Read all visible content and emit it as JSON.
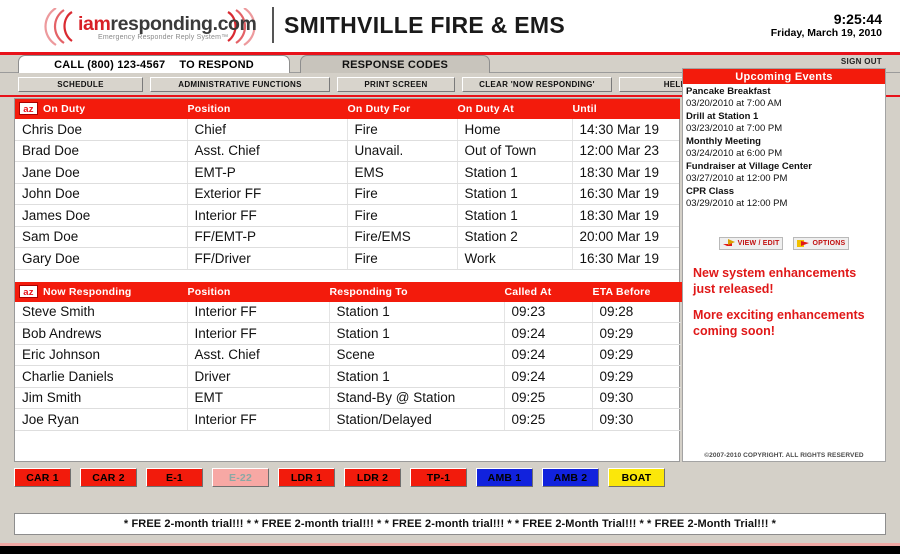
{
  "header": {
    "logo": {
      "brand_part1": "iam",
      "brand_part2": "responding.com",
      "tagline": "Emergency Responder Reply System™",
      "icon_left": "sound-wave-left-icon",
      "icon_right": "sound-wave-right-icon"
    },
    "department_title": "SMITHVILLE FIRE & EMS",
    "clock_time": "9:25:44",
    "clock_date": "Friday, March 19, 2010"
  },
  "tabs": [
    {
      "id": "tab-respond",
      "label_bold": "CALL (800) 123-4567",
      "label_strong": "TO RESPOND",
      "active": true
    },
    {
      "id": "tab-codes",
      "label_bold": "RESPONSE CODES",
      "active": false
    }
  ],
  "toolbar": {
    "schedule_label": "SCHEDULE",
    "admin_label": "ADMINISTRATIVE FUNCTIONS",
    "print_label": "PRINT SCREEN",
    "clear_label": "CLEAR 'NOW RESPONDING'",
    "help_label": "HELP",
    "sign_out_label": "SIGN OUT"
  },
  "on_duty": {
    "sort_badge": "az",
    "columns": [
      "On Duty",
      "Position",
      "On Duty For",
      "On Duty At",
      "Until"
    ],
    "rows": [
      {
        "name": "Chris Doe",
        "position": "Chief",
        "duty_for": "Fire",
        "duty_at": "Home",
        "until": "14:30 Mar 19"
      },
      {
        "name": "Brad Doe",
        "position": "Asst. Chief",
        "duty_for": "Unavail.",
        "duty_at": "Out of Town",
        "until": "12:00 Mar 23"
      },
      {
        "name": "Jane Doe",
        "position": "EMT-P",
        "duty_for": "EMS",
        "duty_at": "Station 1",
        "until": "18:30 Mar 19"
      },
      {
        "name": "John Doe",
        "position": "Exterior FF",
        "duty_for": "Fire",
        "duty_at": "Station 1",
        "until": "16:30 Mar 19"
      },
      {
        "name": "James Doe",
        "position": "Interior FF",
        "duty_for": "Fire",
        "duty_at": "Station 1",
        "until": "18:30 Mar 19"
      },
      {
        "name": "Sam Doe",
        "position": "FF/EMT-P",
        "duty_for": "Fire/EMS",
        "duty_at": "Station 2",
        "until": "20:00 Mar 19"
      },
      {
        "name": "Gary Doe",
        "position": "FF/Driver",
        "duty_for": "Fire",
        "duty_at": "Work",
        "until": "16:30 Mar 19"
      }
    ]
  },
  "now_responding": {
    "sort_badge": "az",
    "columns": [
      "Now Responding",
      "Position",
      "Responding To",
      "Called At",
      "ETA Before"
    ],
    "rows": [
      {
        "name": "Steve Smith",
        "position": "Interior FF",
        "responding_to": "Station 1",
        "called_at": "09:23",
        "eta_before": "09:28"
      },
      {
        "name": "Bob Andrews",
        "position": "Interior FF",
        "responding_to": "Station 1",
        "called_at": "09:24",
        "eta_before": "09:29"
      },
      {
        "name": "Eric Johnson",
        "position": "Asst. Chief",
        "responding_to": "Scene",
        "called_at": "09:24",
        "eta_before": "09:29"
      },
      {
        "name": "Charlie Daniels",
        "position": "Driver",
        "responding_to": "Station 1",
        "called_at": "09:24",
        "eta_before": "09:29"
      },
      {
        "name": "Jim Smith",
        "position": "EMT",
        "responding_to": "Stand-By @ Station",
        "called_at": "09:25",
        "eta_before": "09:30"
      },
      {
        "name": "Joe Ryan",
        "position": "Interior FF",
        "responding_to": "Station/Delayed",
        "called_at": "09:25",
        "eta_before": "09:30"
      }
    ]
  },
  "sidebar": {
    "title": "Upcoming Events",
    "events": [
      {
        "name": "Pancake Breakfast",
        "when": "03/20/2010 at 7:00 AM"
      },
      {
        "name": "Drill at Station 1",
        "when": "03/23/2010 at 7:00 PM"
      },
      {
        "name": "Monthly Meeting",
        "when": "03/24/2010 at 6:00 PM"
      },
      {
        "name": "Fundraiser at Village Center",
        "when": "03/27/2010 at 12:00 PM"
      },
      {
        "name": "CPR Class",
        "when": "03/29/2010 at 12:00 PM"
      }
    ],
    "view_edit_label": "VIEW / EDIT",
    "options_label": "OPTIONS",
    "view_edit_icon": "pencil-flag-icon",
    "options_icon": "wrench-flag-icon",
    "promo_lines": [
      "New system enhancements just released!",
      "More exciting enhancements coming soon!"
    ],
    "copyright": "©2007-2010 COPYRIGHT. ALL RIGHTS RESERVED"
  },
  "units": [
    {
      "label": "CAR 1",
      "bg": "#f21b0c",
      "fg": "#000000"
    },
    {
      "label": "CAR 2",
      "bg": "#f21b0c",
      "fg": "#000000"
    },
    {
      "label": "E-1",
      "bg": "#f21b0c",
      "fg": "#000000"
    },
    {
      "label": "E-22",
      "bg": "#f7a8a4",
      "fg": "#8aa8a4"
    },
    {
      "label": "LDR 1",
      "bg": "#f21b0c",
      "fg": "#000000"
    },
    {
      "label": "LDR 2",
      "bg": "#f21b0c",
      "fg": "#000000"
    },
    {
      "label": "TP-1",
      "bg": "#f21b0c",
      "fg": "#000000"
    },
    {
      "label": "AMB 1",
      "bg": "#1122dd",
      "fg": "#000000"
    },
    {
      "label": "AMB 2",
      "bg": "#1122dd",
      "fg": "#000000"
    },
    {
      "label": "BOAT",
      "bg": "#fbe70a",
      "fg": "#000000"
    }
  ],
  "marquee": {
    "text": "* FREE 2-month trial!!! *  * FREE 2-month trial!!! *  * FREE 2-month trial!!! *  * FREE 2-Month Trial!!! *  * FREE 2-Month Trial!!! *"
  },
  "colors": {
    "brand_red": "#e8121a",
    "table_header_red": "#f31b0c",
    "promo_red": "#e01818",
    "window_gray": "#d4d0c8"
  }
}
